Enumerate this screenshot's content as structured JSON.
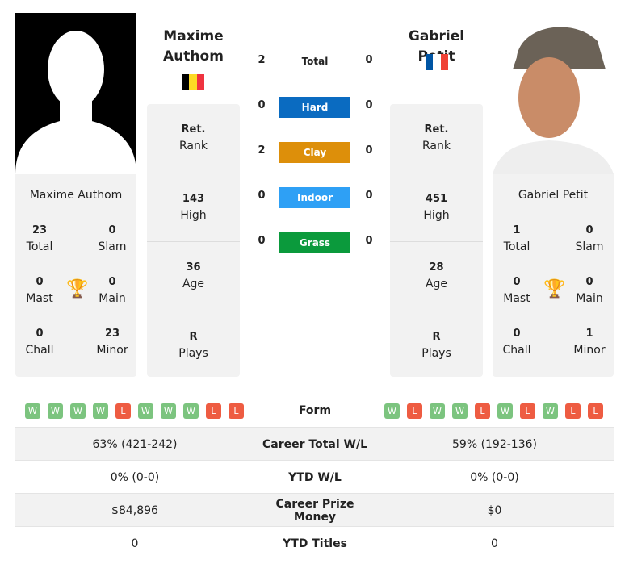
{
  "left": {
    "name": "Maxime Authom",
    "title": "Maxime Authom",
    "flag_colors": [
      "#000000",
      "#fdda24",
      "#ef3340"
    ],
    "total": "23",
    "slam": "0",
    "mast": "0",
    "main": "0",
    "chall": "0",
    "minor": "23",
    "rank": "Ret.",
    "high": "143",
    "age": "36",
    "plays": "R",
    "form": [
      "W",
      "W",
      "W",
      "W",
      "L",
      "W",
      "W",
      "W",
      "L",
      "L"
    ]
  },
  "right": {
    "name": "Gabriel Petit",
    "title": "Gabriel Petit",
    "flag_colors": [
      "#0055a4",
      "#ffffff",
      "#ef4135"
    ],
    "total": "1",
    "slam": "0",
    "mast": "0",
    "main": "0",
    "chall": "0",
    "minor": "1",
    "rank": "Ret.",
    "high": "451",
    "age": "28",
    "plays": "R",
    "form": [
      "W",
      "L",
      "W",
      "W",
      "L",
      "W",
      "L",
      "W",
      "L",
      "L"
    ]
  },
  "labels": {
    "total": "Total",
    "slam": "Slam",
    "mast": "Mast",
    "main": "Main",
    "chall": "Chall",
    "minor": "Minor",
    "rank": "Rank",
    "high": "High",
    "age": "Age",
    "plays": "Plays",
    "form": "Form"
  },
  "h2h": [
    {
      "label": "Total",
      "l": "2",
      "r": "0"
    },
    {
      "label": "Hard",
      "l": "0",
      "r": "0",
      "color": "#0a6bc1"
    },
    {
      "label": "Clay",
      "l": "2",
      "r": "0",
      "color": "#dd8f0a"
    },
    {
      "label": "Indoor",
      "l": "0",
      "r": "0",
      "color": "#2ea0f5"
    },
    {
      "label": "Grass",
      "l": "0",
      "r": "0",
      "color": "#0b9a3c"
    }
  ],
  "table": [
    {
      "label": "Career Total W/L",
      "l": "63% (421-242)",
      "r": "59% (192-136)"
    },
    {
      "label": "YTD W/L",
      "l": "0% (0-0)",
      "r": "0% (0-0)"
    },
    {
      "label": "Career Prize Money",
      "l": "$84,896",
      "r": "$0"
    },
    {
      "label": "YTD Titles",
      "l": "0",
      "r": "0"
    }
  ]
}
